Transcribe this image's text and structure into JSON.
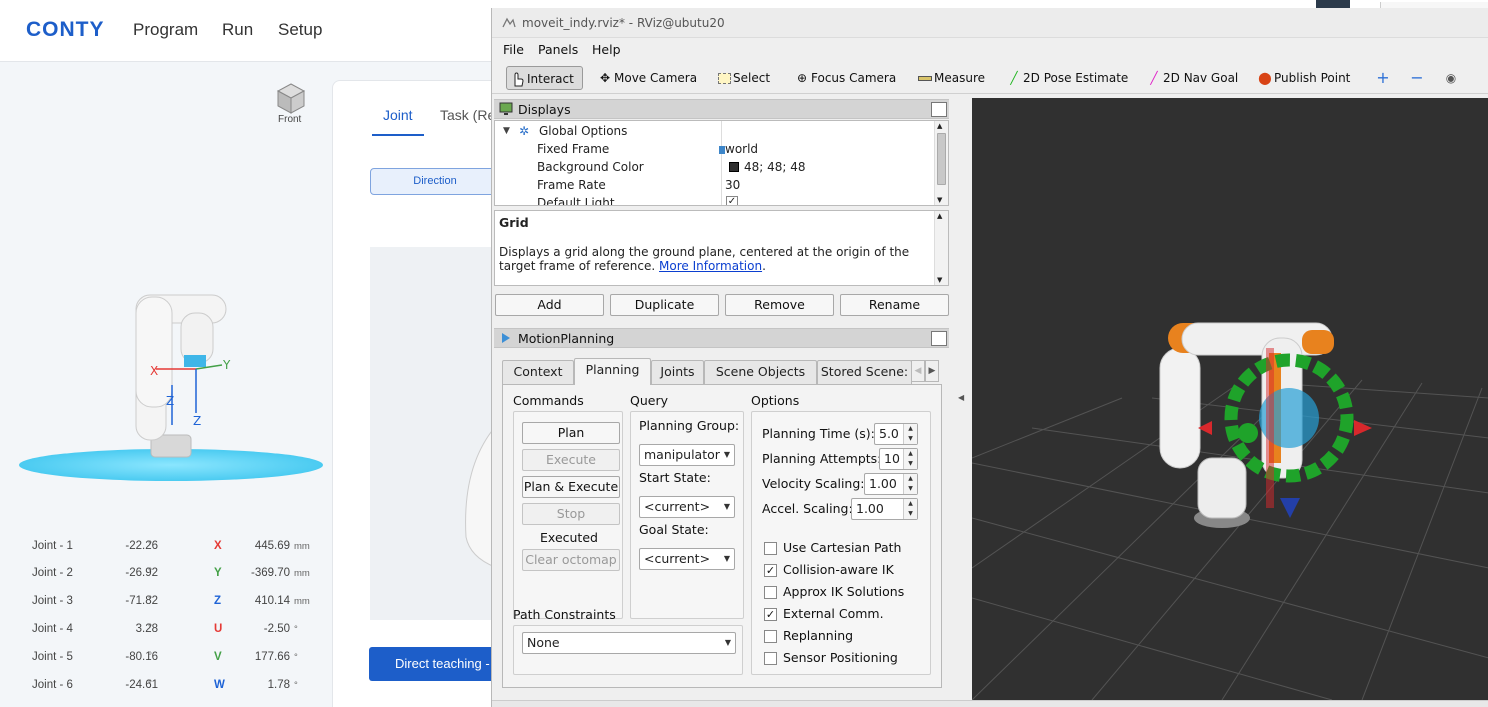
{
  "conty": {
    "logo": "CONTY",
    "nav": [
      "Program",
      "Run",
      "Setup"
    ],
    "view_cube_label": "Front",
    "tabs": {
      "joint": "Joint",
      "task": "Task (Re"
    },
    "direction_label": "Direction",
    "direct_teaching_label": "Direct teaching -",
    "joints": [
      {
        "name": "Joint - 1",
        "value": "-22.26",
        "unit": "°"
      },
      {
        "name": "Joint - 2",
        "value": "-26.92",
        "unit": "°"
      },
      {
        "name": "Joint - 3",
        "value": "-71.82",
        "unit": "°"
      },
      {
        "name": "Joint - 4",
        "value": "3.28",
        "unit": "°"
      },
      {
        "name": "Joint - 5",
        "value": "-80.16",
        "unit": "°"
      },
      {
        "name": "Joint - 6",
        "value": "-24.61",
        "unit": "°"
      }
    ],
    "cartesian": [
      {
        "axis": "X",
        "value": "445.69",
        "unit": "mm",
        "color": "#e53935"
      },
      {
        "axis": "Y",
        "value": "-369.70",
        "unit": "mm",
        "color": "#43a047"
      },
      {
        "axis": "Z",
        "value": "410.14",
        "unit": "mm",
        "color": "#1e63d6"
      },
      {
        "axis": "U",
        "value": "-2.50",
        "unit": "°",
        "color": "#e53935"
      },
      {
        "axis": "V",
        "value": "177.66",
        "unit": "°",
        "color": "#43a047"
      },
      {
        "axis": "W",
        "value": "1.78",
        "unit": "°",
        "color": "#1e63d6"
      }
    ],
    "axis_labels": {
      "x": "X",
      "y": "Y",
      "z": "Z"
    }
  },
  "rviz": {
    "title": "moveit_indy.rviz* - RViz@ubutu20",
    "menu": [
      "File",
      "Panels",
      "Help"
    ],
    "toolbar": {
      "interact": "Interact",
      "move_camera": "Move Camera",
      "select": "Select",
      "focus_camera": "Focus Camera",
      "measure": "Measure",
      "pose_estimate": "2D Pose Estimate",
      "nav_goal": "2D Nav Goal",
      "publish_point": "Publish Point"
    },
    "displays": {
      "title": "Displays",
      "tree": [
        {
          "label": "Global Options",
          "value": ""
        },
        {
          "label": "Fixed Frame",
          "value": "world"
        },
        {
          "label": "Background Color",
          "value": "48; 48; 48"
        },
        {
          "label": "Frame Rate",
          "value": "30"
        },
        {
          "label": "Default Light",
          "value": "✓"
        }
      ],
      "description_title": "Grid",
      "description_text": "Displays a grid along the ground plane, centered at the origin of the target frame of reference.",
      "description_link": "More Information",
      "buttons": {
        "add": "Add",
        "duplicate": "Duplicate",
        "remove": "Remove",
        "rename": "Rename"
      }
    },
    "motion_planning": {
      "title": "MotionPlanning",
      "tabs": [
        "Context",
        "Planning",
        "Joints",
        "Scene Objects",
        "Stored Scene:"
      ],
      "commands": {
        "title": "Commands",
        "plan": "Plan",
        "execute": "Execute",
        "plan_execute": "Plan & Execute",
        "stop": "Stop",
        "status": "Executed",
        "clear_octomap": "Clear octomap"
      },
      "query": {
        "title": "Query",
        "planning_group_label": "Planning Group:",
        "planning_group_value": "manipulator",
        "start_state_label": "Start State:",
        "start_state_value": "<current>",
        "goal_state_label": "Goal State:",
        "goal_state_value": "<current>"
      },
      "options": {
        "title": "Options",
        "planning_time_label": "Planning Time (s):",
        "planning_time": "5.0",
        "planning_attempts_label": "Planning Attempts:",
        "planning_attempts": "10",
        "velocity_scaling_label": "Velocity Scaling:",
        "velocity_scaling": "1.00",
        "accel_scaling_label": "Accel. Scaling:",
        "accel_scaling": "1.00",
        "checkboxes": [
          {
            "label": "Use Cartesian Path",
            "checked": ""
          },
          {
            "label": "Collision-aware IK",
            "checked": "✓"
          },
          {
            "label": "Approx IK Solutions",
            "checked": ""
          },
          {
            "label": "External Comm.",
            "checked": "✓"
          },
          {
            "label": "Replanning",
            "checked": ""
          },
          {
            "label": "Sensor Positioning",
            "checked": ""
          }
        ]
      },
      "path_constraints_label": "Path Constraints",
      "path_constraints_value": "None"
    }
  },
  "colors": {
    "conty_blue": "#1d5ec9",
    "viewport_bg": "#303030",
    "robot_orange": "#e8821e",
    "marker_green": "#1fa32a"
  }
}
